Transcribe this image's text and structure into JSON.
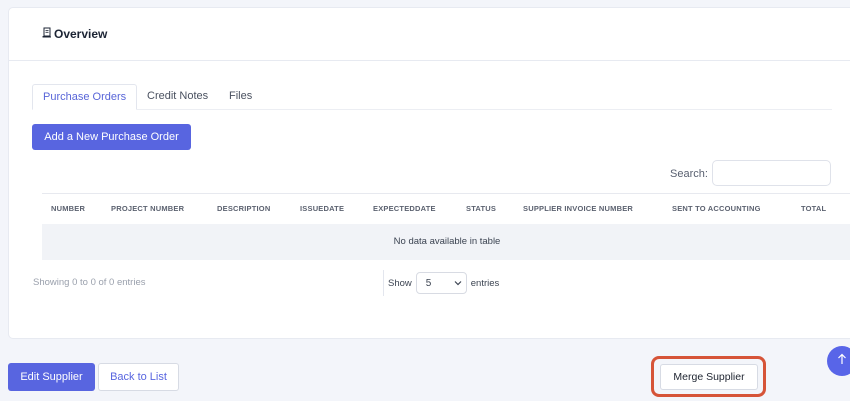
{
  "card": {
    "title": "Overview",
    "title_icon": "document-icon"
  },
  "tabs": [
    {
      "label": "Purchase Orders",
      "active": true
    },
    {
      "label": "Credit Notes",
      "active": false
    },
    {
      "label": "Files",
      "active": false
    }
  ],
  "add_button_label": "Add a New Purchase Order",
  "search": {
    "label": "Search:",
    "placeholder": "",
    "value": ""
  },
  "table": {
    "columns": [
      "NUMBER",
      "PROJECT NUMBER",
      "DESCRIPTION",
      "ISSUEDATE",
      "EXPECTEDDATE",
      "STATUS",
      "SUPPLIER INVOICE NUMBER",
      "SENT TO ACCOUNTING",
      "TOTAL"
    ],
    "empty_message": "No data available in table"
  },
  "footer": {
    "showing": "Showing 0 to 0 of 0 entries",
    "show_label": "Show",
    "entries_label": "entries",
    "page_length": "5"
  },
  "actions": {
    "edit_label": "Edit Supplier",
    "back_label": "Back to List",
    "merge_label": "Merge Supplier"
  },
  "colors": {
    "primary": "#5865e0",
    "highlight": "#d65438"
  }
}
